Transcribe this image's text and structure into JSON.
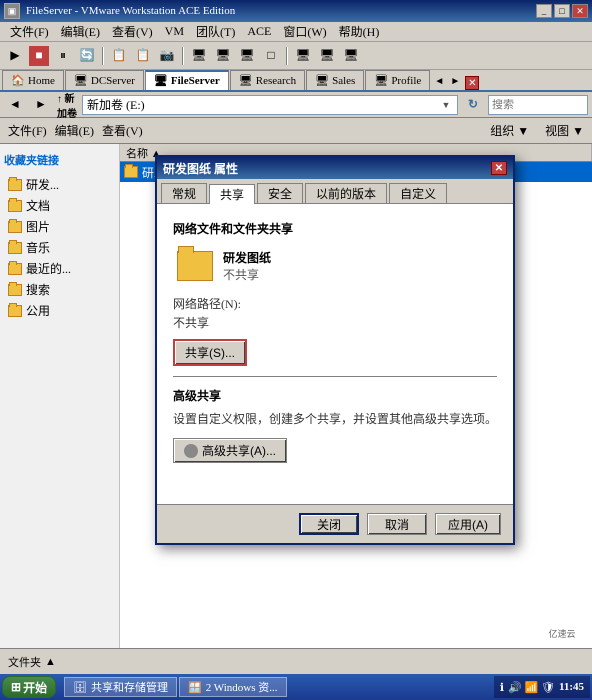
{
  "window": {
    "title": "FileServer - VMware Workstation ACE Edition",
    "icon": "vm-icon"
  },
  "menu": {
    "items": [
      "文件(F)",
      "编辑(E)",
      "查看(V)",
      "VM",
      "团队(T)",
      "ACE",
      "窗口(W)",
      "帮助(H)"
    ]
  },
  "tabs": {
    "items": [
      {
        "label": "Home",
        "icon": "home-icon",
        "active": false
      },
      {
        "label": "DCServer",
        "icon": "vm-tab-icon",
        "active": false
      },
      {
        "label": "FileServer",
        "icon": "vm-tab-icon",
        "active": true
      },
      {
        "label": "Research",
        "icon": "vm-tab-icon",
        "active": false
      },
      {
        "label": "Sales",
        "icon": "vm-tab-icon",
        "active": false
      },
      {
        "label": "Profile",
        "icon": "vm-tab-icon",
        "active": false
      }
    ]
  },
  "address_bar": {
    "back_btn": "◄",
    "forward_btn": "►",
    "up_btn": "↑",
    "address_label": "新加卷 (E:)",
    "search_placeholder": "搜索",
    "go_btn": "→"
  },
  "toolbar2": {
    "items": [
      {
        "label": "文件(F)",
        "has_arrow": true
      },
      {
        "label": "编辑(E)",
        "has_arrow": true
      },
      {
        "label": "查看(V)",
        "has_arrow": true
      },
      {
        "label": "组织 ▼"
      },
      {
        "label": "视图 ▼"
      }
    ]
  },
  "sidebar": {
    "section_title": "收藏夹链接",
    "items": [
      {
        "label": "研发...",
        "icon": "folder-icon"
      },
      {
        "label": "文档",
        "icon": "folder-icon"
      },
      {
        "label": "图片",
        "icon": "folder-icon"
      },
      {
        "label": "音乐",
        "icon": "folder-icon"
      },
      {
        "label": "最近的...",
        "icon": "folder-icon"
      },
      {
        "label": "搜索",
        "icon": "folder-icon"
      },
      {
        "label": "公用",
        "icon": "folder-icon"
      }
    ]
  },
  "file_list": {
    "column_header": "名称 ▲",
    "items": [
      {
        "name": "研发图纸",
        "selected": true
      }
    ]
  },
  "dialog": {
    "title": "研发图纸 属性",
    "tabs": [
      "常规",
      "共享",
      "安全",
      "以前的版本",
      "自定义"
    ],
    "active_tab": "共享",
    "share_section": {
      "title": "网络文件和文件夹共享",
      "folder_name": "研发图纸",
      "status": "不共享",
      "network_path_label": "网络路径(N):",
      "network_path_value": "不共享",
      "share_btn": "共享(S)..."
    },
    "advanced_section": {
      "title": "高级共享",
      "description": "设置自定义权限，创建多个共享，并设置其他高级共享选项。",
      "btn_label": "高级共享(A)..."
    },
    "footer": {
      "close_btn": "关闭",
      "cancel_btn": "取消",
      "apply_btn": "应用(A)"
    }
  },
  "status_bar": {
    "folder_label": "文件夹",
    "up_icon": "▲"
  },
  "taskbar": {
    "start_label": "开始",
    "items": [
      {
        "label": "共享和存储管理"
      },
      {
        "label": "2 Windows 资..."
      }
    ],
    "tray": {
      "icons": [
        "🔊",
        "📶",
        "🛡"
      ],
      "time": "11:45"
    }
  },
  "watermark": "亿速云"
}
